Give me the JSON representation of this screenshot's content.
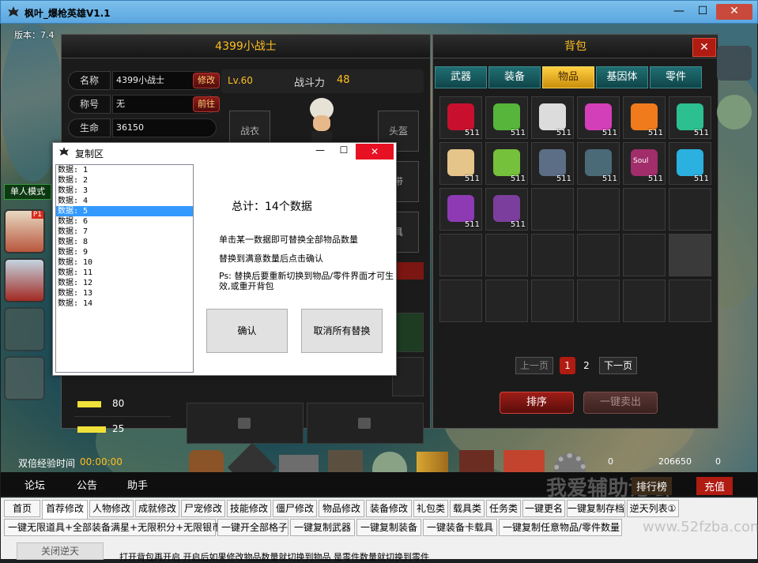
{
  "window": {
    "title": "枫叶_爆枪英雄V1.1",
    "min": "—",
    "max": "☐",
    "close": "✕"
  },
  "version_label": "版本：7.4",
  "character": {
    "header": "4399小战士",
    "level": "Lv.60",
    "power_label": "战斗力",
    "power_value": "48",
    "fields": [
      {
        "label": "名称",
        "value": "4399小战士",
        "btn": "修改"
      },
      {
        "label": "称号",
        "value": "无",
        "btn": "前往"
      },
      {
        "label": "生命",
        "value": "36150",
        "btn": ""
      }
    ],
    "slots": {
      "robe": "战衣",
      "helmet": "头盔",
      "belt": "带",
      "partial": "具"
    },
    "weapon_counts": [
      "80",
      "25"
    ]
  },
  "left_side": {
    "single_mode": "单人模式",
    "p1_badge": "P1"
  },
  "backpack": {
    "title": "背包",
    "tabs": [
      "武器",
      "装备",
      "物品",
      "基因体",
      "零件"
    ],
    "active_tab": 2,
    "items": [
      {
        "icon": "potion-icon",
        "count": "511"
      },
      {
        "icon": "green-crate-icon",
        "count": "511"
      },
      {
        "icon": "phone-icon",
        "count": "511"
      },
      {
        "icon": "pink-gem-icon",
        "count": "511"
      },
      {
        "icon": "orange-gem-icon",
        "count": "511"
      },
      {
        "icon": "green-gem-icon",
        "count": "511"
      },
      {
        "icon": "scroll-icon",
        "count": "511"
      },
      {
        "icon": "test-tube-icon",
        "count": "511"
      },
      {
        "icon": "eye-box-icon",
        "count": "511"
      },
      {
        "icon": "steel-box-icon",
        "count": "511"
      },
      {
        "icon": "soul-box-icon",
        "count": "511"
      },
      {
        "icon": "card-icon",
        "count": "511"
      },
      {
        "icon": "purple-eye-box-icon",
        "count": "511"
      },
      {
        "icon": "purple-box-icon",
        "count": "511"
      }
    ],
    "soul_text": "Soul",
    "prev": "上一页",
    "next": "下一页",
    "pages": [
      "1",
      "2"
    ],
    "sort": "排序",
    "sell_all": "一键卖出"
  },
  "dialog": {
    "title": "复制区",
    "list": [
      "数据: 1",
      "数据: 2",
      "数据: 3",
      "数据: 4",
      "数据: 5",
      "数据: 6",
      "数据: 7",
      "数据: 8",
      "数据: 9",
      "数据: 10",
      "数据: 11",
      "数据: 12",
      "数据: 13",
      "数据: 14"
    ],
    "selected": 4,
    "total": "总计：14个数据",
    "line1": "单击某一数据即可替换全部物品数量",
    "line2": "替换到满意数量后点击确认",
    "line3": "Ps: 替换后要重新切换到物品/零件界面才可生效,或重开背包",
    "confirm": "确认",
    "cancel": "取消所有替换"
  },
  "status": {
    "exp_label": "双倍经验时间",
    "exp_time": "00:00:00",
    "points": "0",
    "money": "206650",
    "gold": "0"
  },
  "nav": {
    "forum": "论坛",
    "notice": "公告",
    "helper": "助手",
    "rank": "排行榜",
    "recharge": "充值"
  },
  "watermark": "我爱辅助论坛",
  "watermark_url": "www.52fzba.com",
  "tool_tabs": [
    "首页",
    "首荐修改",
    "人物修改",
    "成就修改",
    "尸宠修改",
    "技能修改",
    "僵尸修改",
    "物品修改",
    "装备修改",
    "礼包类",
    "载具类",
    "任务类",
    "一键更名",
    "一键复制存档",
    "逆天列表①"
  ],
  "active_tool_tab": 1,
  "sub_buttons": [
    "一键无限道具+全部装备满星+无限积分+无限银币",
    "一键开全部格子",
    "一键复制武器",
    "一键复制装备",
    "一键装备卡载具",
    "一键复制任意物品/零件数量"
  ],
  "bottom_btn": "关闭逆天",
  "bottom_note": "打开背包再开启 开启后如果修改物品数量就切换到物品 是零件数量就切换到零件",
  "colors": {
    "accent": "#ffbf1f",
    "tab_teal": "#1f6f73",
    "red": "#8a1c18"
  }
}
